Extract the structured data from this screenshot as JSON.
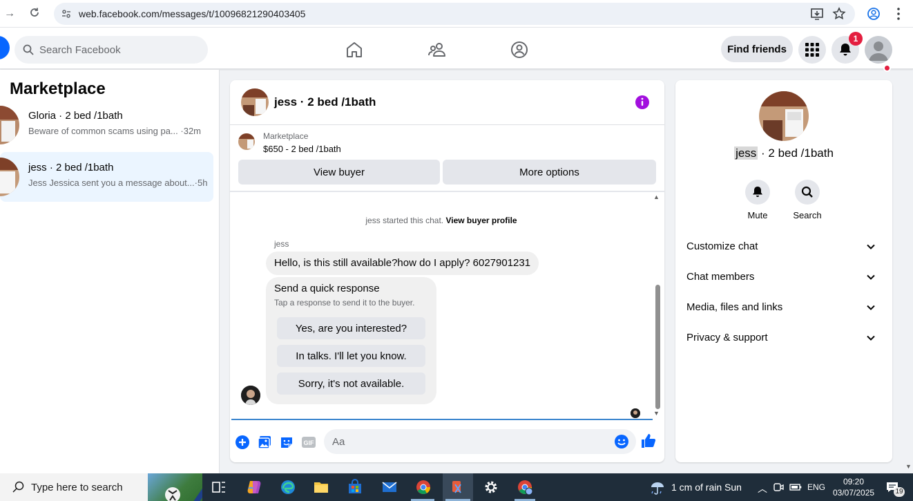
{
  "browser": {
    "url": "web.facebook.com/messages/t/10096821290403405"
  },
  "header": {
    "search_placeholder": "Search Facebook",
    "find_friends_label": "Find friends",
    "notification_count": "1"
  },
  "sidebar": {
    "title": "Marketplace",
    "conversations": [
      {
        "name": "Gloria · 2 bed /1bath",
        "preview": "Beware of common scams using pa...",
        "time": "·32m"
      },
      {
        "name": "jess · 2 bed /1bath",
        "preview": "Jess Jessica sent you a message about...",
        "time": "·5h"
      }
    ]
  },
  "chat": {
    "title": "jess · 2 bed /1bath",
    "listing_label": "Marketplace",
    "listing_price": "$650 - 2 bed /1bath",
    "view_buyer_label": "View buyer",
    "more_options_label": "More options",
    "system_message": "jess started this chat.",
    "system_link": "View buyer profile",
    "sender_name": "jess",
    "message": "Hello, is this still available?how do I apply? 6027901231",
    "quick_title": "Send a quick response",
    "quick_subtitle": "Tap a response to send it to the buyer.",
    "quick_responses": [
      "Yes, are you interested?",
      "In talks. I'll let you know.",
      "Sorry, it's not available."
    ],
    "compose_placeholder": "Aa"
  },
  "details": {
    "name_highlight": "jess",
    "name_rest": " · 2 bed /1bath",
    "mute_label": "Mute",
    "search_label": "Search",
    "sections": [
      "Customize chat",
      "Chat members",
      "Media, files and links",
      "Privacy & support"
    ]
  },
  "taskbar": {
    "search_placeholder": "Type here to search",
    "weather": "1 cm of rain Sun",
    "language": "ENG",
    "time": "09:20",
    "date": "03/07/2025",
    "notification_count": "19"
  },
  "colors": {
    "fb_blue": "#0866ff",
    "purple_info": "#a20fde",
    "active_conv_bg": "#ebf5ff",
    "badge_red": "#e41e3f"
  },
  "icons": [
    "reload-icon",
    "site-info-icon",
    "install-icon",
    "star-icon",
    "profile-icon",
    "menu-icon",
    "search-icon",
    "home-icon",
    "friends-icon",
    "groups-icon",
    "grid-menu-icon",
    "bell-icon",
    "info-icon",
    "plus-icon",
    "photo-icon",
    "sticker-icon",
    "gif-icon",
    "emoji-icon",
    "thumbs-up-icon",
    "chevron-down-icon"
  ]
}
